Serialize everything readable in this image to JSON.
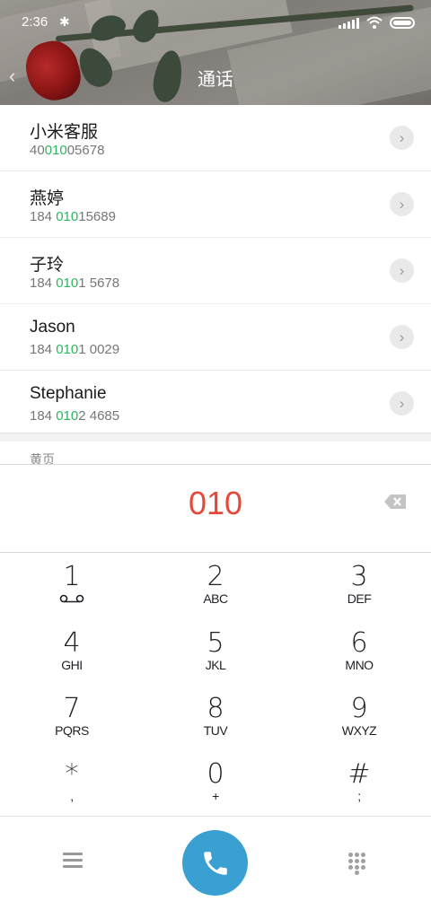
{
  "status_bar": {
    "time": "2:36",
    "bluetooth_icon": "bluetooth-icon"
  },
  "header": {
    "title": "通话",
    "back_icon": "back-chevron-icon"
  },
  "contacts": [
    {
      "name": "小米客服",
      "number_pre": "40",
      "number_match": "010",
      "number_post": "05678"
    },
    {
      "name": "燕婷",
      "number_pre": "184 ",
      "number_match": "010",
      "number_post": "15689"
    },
    {
      "name": "子玲",
      "number_pre": "184 ",
      "number_match": "010",
      "number_post": "1 5678"
    },
    {
      "name": "Jason",
      "number_pre": "184 ",
      "number_match": "010",
      "number_post": "1 0029"
    },
    {
      "name": "Stephanie",
      "number_pre": "184 ",
      "number_match": "010",
      "number_post": "2 4685"
    }
  ],
  "section_label": "黄页",
  "dial_input": {
    "value": "010"
  },
  "keypad": [
    {
      "digit": "1",
      "letters": ""
    },
    {
      "digit": "2",
      "letters": "ABC"
    },
    {
      "digit": "3",
      "letters": "DEF"
    },
    {
      "digit": "4",
      "letters": "GHI"
    },
    {
      "digit": "5",
      "letters": "JKL"
    },
    {
      "digit": "6",
      "letters": "MNO"
    },
    {
      "digit": "7",
      "letters": "PQRS"
    },
    {
      "digit": "8",
      "letters": "TUV"
    },
    {
      "digit": "9",
      "letters": "WXYZ"
    },
    {
      "digit": "*",
      "letters": ","
    },
    {
      "digit": "0",
      "letters": "+"
    },
    {
      "digit": "#",
      "letters": ";"
    }
  ],
  "colors": {
    "match_highlight": "#2ab65e",
    "dialed_text": "#e24a3b",
    "call_button": "#3aa0d2"
  }
}
